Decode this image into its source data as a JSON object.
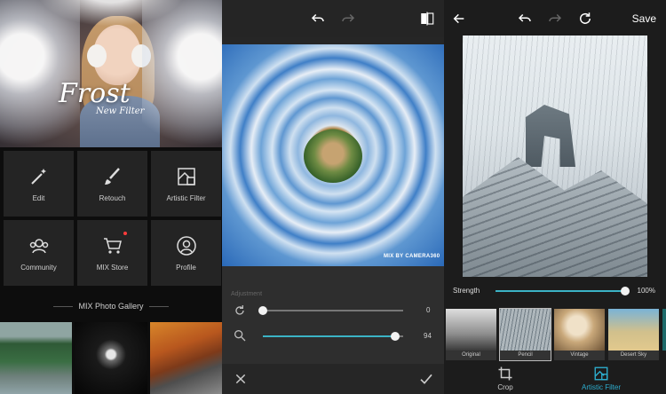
{
  "home": {
    "hero": {
      "title": "Frost",
      "subtitle": "New Filter"
    },
    "tiles": [
      {
        "label": "Edit",
        "icon": "magic-wand-icon"
      },
      {
        "label": "Retouch",
        "icon": "brush-icon"
      },
      {
        "label": "Artistic Filter",
        "icon": "artistic-filter-icon"
      },
      {
        "label": "Community",
        "icon": "community-icon"
      },
      {
        "label": "MIX Store",
        "icon": "cart-icon",
        "badge": true
      },
      {
        "label": "Profile",
        "icon": "profile-icon"
      }
    ],
    "gallery_title": "MIX Photo Gallery"
  },
  "editor": {
    "watermark": "MIX BY CAMERA360",
    "adjustment_label": "Adjustment",
    "sliders": [
      {
        "icon": "rotate-icon",
        "value": 0
      },
      {
        "icon": "zoom-icon",
        "value": 94
      }
    ]
  },
  "artistic": {
    "save_label": "Save",
    "strength_label": "Strength",
    "strength_value": "100%",
    "strength": 100,
    "filters": [
      {
        "name": "Original",
        "selected": false
      },
      {
        "name": "Pencil",
        "selected": true
      },
      {
        "name": "Vintage",
        "selected": false
      },
      {
        "name": "Desert Sky",
        "selected": false
      },
      {
        "name": "",
        "selected": false
      }
    ],
    "tabs": [
      {
        "label": "Crop",
        "active": false
      },
      {
        "label": "Artistic Filter",
        "active": true
      }
    ]
  },
  "colors": {
    "accent": "#3bb3c5",
    "active_tab": "#2dafd0",
    "badge": "#ff3b3b"
  }
}
